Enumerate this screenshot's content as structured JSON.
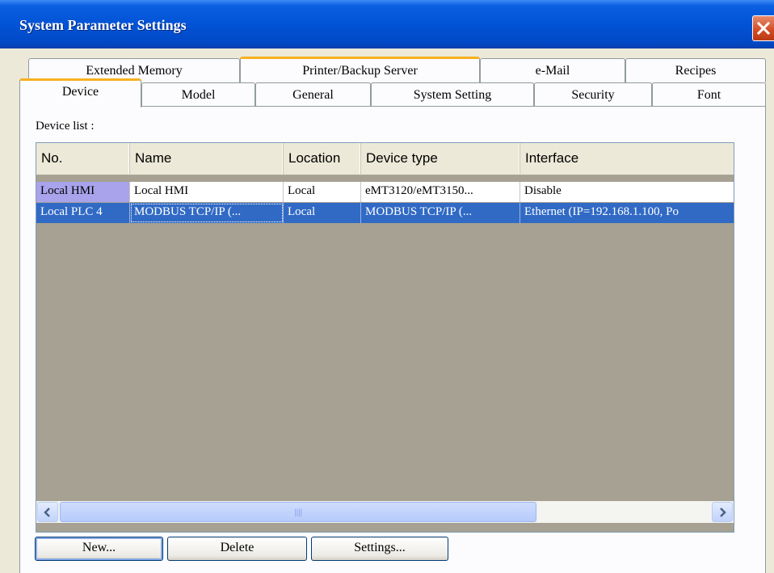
{
  "window": {
    "title": "System Parameter Settings"
  },
  "tabs": {
    "back_row": [
      {
        "label": "Extended Memory"
      },
      {
        "label": "Printer/Backup Server"
      },
      {
        "label": "e-Mail"
      },
      {
        "label": "Recipes"
      }
    ],
    "front_row": [
      {
        "label": "Device"
      },
      {
        "label": "Model"
      },
      {
        "label": "General"
      },
      {
        "label": "System Setting"
      },
      {
        "label": "Security"
      },
      {
        "label": "Font"
      }
    ],
    "active": "Device"
  },
  "device_list": {
    "label": "Device list :",
    "columns": [
      "No.",
      "Name",
      "Location",
      "Device type",
      "Interface"
    ],
    "rows": [
      [
        "Local HMI",
        "Local HMI",
        "Local",
        "eMT3120/eMT3150...",
        "Disable"
      ],
      [
        "Local PLC 4",
        "MODBUS TCP/IP (...",
        "Local",
        "MODBUS TCP/IP (...",
        "Ethernet (IP=192.168.1.100, Po"
      ]
    ],
    "selected_row": 1
  },
  "scrollbar": {
    "left_icon": "chevron-left-icon",
    "right_icon": "chevron-right-icon"
  },
  "buttons": {
    "new": "New...",
    "delete": "Delete",
    "settings": "Settings..."
  },
  "colors": {
    "titlebar": "#0253d6",
    "selection": "#316ac5",
    "tab_highlight": "#f7b11f",
    "list_background": "#a6a192"
  }
}
